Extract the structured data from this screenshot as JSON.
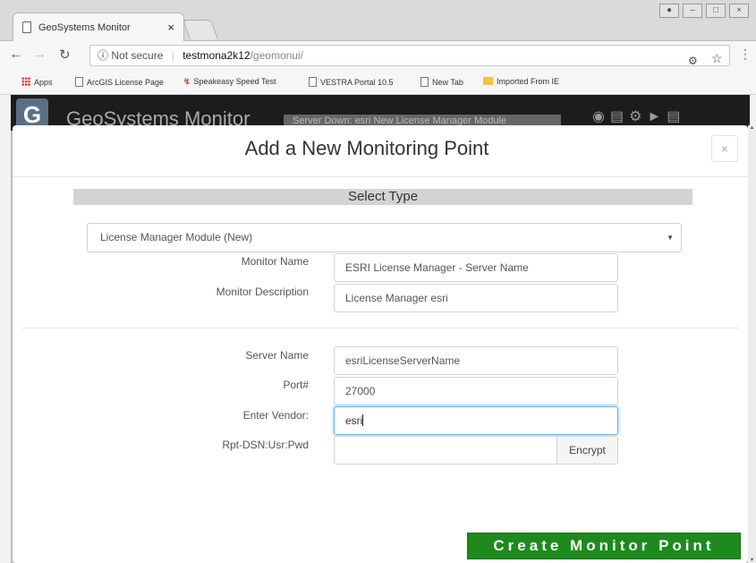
{
  "browser": {
    "tab_title": "GeoSystems Monitor",
    "tab_close": "×",
    "url_security": "Not secure",
    "url_host": "testmona2k12",
    "url_path": "/geomonui/",
    "bookmarks": [
      "Apps",
      "ArcGIS License Page",
      "Speakeasy Speed Test",
      "VESTRA Portal 10.5",
      "New Tab",
      "Imported From IE"
    ]
  },
  "app": {
    "logo": "G",
    "title": "GeoSystems Monitor",
    "subtitle": "Server Down: esri New License Manager Module"
  },
  "modal": {
    "title": "Add a New Monitoring Point",
    "close": "×",
    "section": "Select Type",
    "type_selected": "License Manager Module (New)",
    "fields": {
      "monitor_name_label": "Monitor Name",
      "monitor_name_value": "ESRI License Manager - Server Name",
      "monitor_desc_label": "Monitor Description",
      "monitor_desc_value": "License Manager esri",
      "server_name_label": "Server Name",
      "server_name_value": "esriLicenseServerName",
      "port_label": "Port#",
      "port_value": "27000",
      "vendor_label": "Enter Vendor:",
      "vendor_value": "esri",
      "rpt_label": "Rpt-DSN:Usr:Pwd",
      "rpt_value": ""
    },
    "encrypt_label": "Encrypt",
    "create_label": "Create Monitor Point"
  },
  "colors": {
    "create_button": "#1e8a1e",
    "focus_ring": "#66afe9",
    "app_header": "#1c1c1c"
  }
}
